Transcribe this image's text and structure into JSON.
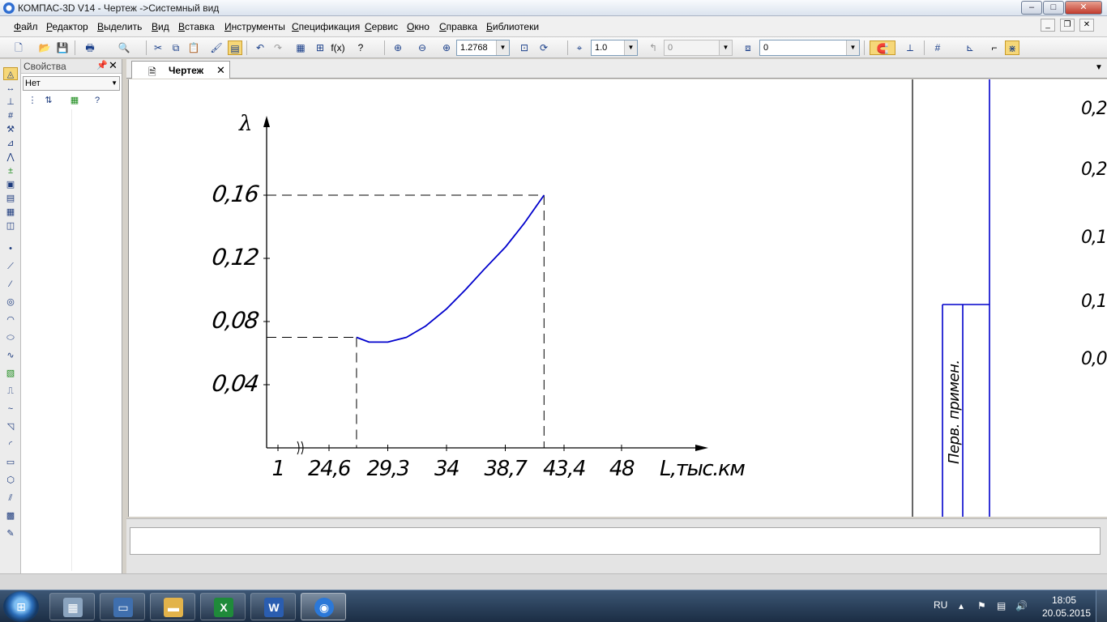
{
  "window": {
    "title": "КОМПАС-3D V14 - Чертеж ->Системный вид",
    "min_label": "–",
    "max_label": "□",
    "close_label": "✕"
  },
  "menu": [
    "Файл",
    "Редактор",
    "Выделить",
    "Вид",
    "Вставка",
    "Инструменты",
    "Спецификация",
    "Сервис",
    "Окно",
    "Справка",
    "Библиотеки"
  ],
  "toolbar": {
    "zoom_value": "1.2768",
    "step_value": "1.0",
    "angle_value": "0",
    "layer_value": "0"
  },
  "properties_panel": {
    "title": "Свойства",
    "selector_value": "Нет"
  },
  "document_tab": {
    "label": "Чертеж"
  },
  "drawing": {
    "y_axis_label": "λ",
    "x_axis_label": "L,тыс.км",
    "y_ticks": [
      "0,04",
      "0,08",
      "0,12",
      "0,16"
    ],
    "x_ticks": [
      "1",
      "24,6",
      "29,3",
      "34",
      "38,7",
      "43,4",
      "48"
    ],
    "stamp_text": "Перв. примен.",
    "right_values": [
      "0,2",
      "0,2",
      "0,1",
      "0,1",
      "0,0"
    ],
    "curve_color": "#0000cc"
  },
  "chart_data": {
    "type": "line",
    "title": "",
    "xlabel": "L,тыс.км",
    "ylabel": "λ",
    "x_ticks": [
      1,
      24.6,
      29.3,
      34,
      38.7,
      43.4,
      48
    ],
    "ylim": [
      0,
      0.18
    ],
    "y_ticks": [
      0.04,
      0.08,
      0.12,
      0.16
    ],
    "series": [
      {
        "x": [
          26.8,
          27.8,
          29.3,
          30.8,
          32.3,
          34,
          35.5,
          37.0,
          38.7,
          40.2,
          41.8
        ],
        "y": [
          0.07,
          0.067,
          0.067,
          0.07,
          0.077,
          0.088,
          0.1,
          0.113,
          0.127,
          0.142,
          0.16
        ]
      }
    ],
    "reference_lines": [
      {
        "x": 26.8,
        "y": 0.07
      },
      {
        "x": 41.8,
        "y": 0.16
      }
    ],
    "axis_break": "after 1",
    "grid": false
  },
  "taskbar": {
    "lang": "RU",
    "time": "18:05",
    "date": "20.05.2015",
    "apps": [
      "calculator",
      "remote-desktop",
      "explorer",
      "excel",
      "word",
      "kompas"
    ]
  }
}
